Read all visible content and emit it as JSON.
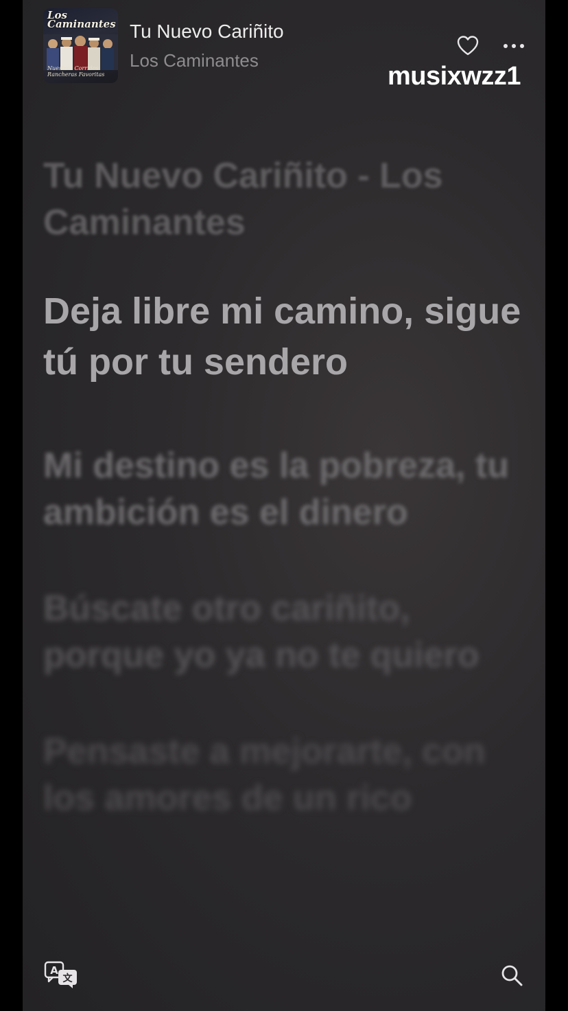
{
  "now_playing": {
    "title": "Tu Nuevo Cariñito",
    "artist": "Los Caminantes",
    "artwork": {
      "logo_text": "Los Caminantes",
      "caption": "Nuestros Corridos Rancheras Favoritas"
    }
  },
  "actions": {
    "favorite_icon": "heart-icon",
    "more_icon": "ellipsis-icon"
  },
  "watermark": "musixwzz1",
  "lyrics": [
    "Tu Nuevo Cariñito - Los Caminantes",
    "Deja libre mi camino, sigue tú por tu sendero",
    "Mi destino es la pobreza, tu ambición es el dinero",
    "Búscate otro cariñito, porque yo ya no te quiero",
    "Pensaste a mejorarte, con los amores de un rico"
  ],
  "bottom_bar": {
    "translate_icon": "translate-icon",
    "search_icon": "search-icon"
  },
  "colors": {
    "background": "#2c2a2c",
    "active_lyric": "#a8a6a8",
    "inactive_lyric": "#6d6b6d",
    "title": "#ededed",
    "subtitle": "#8e8c8e"
  }
}
